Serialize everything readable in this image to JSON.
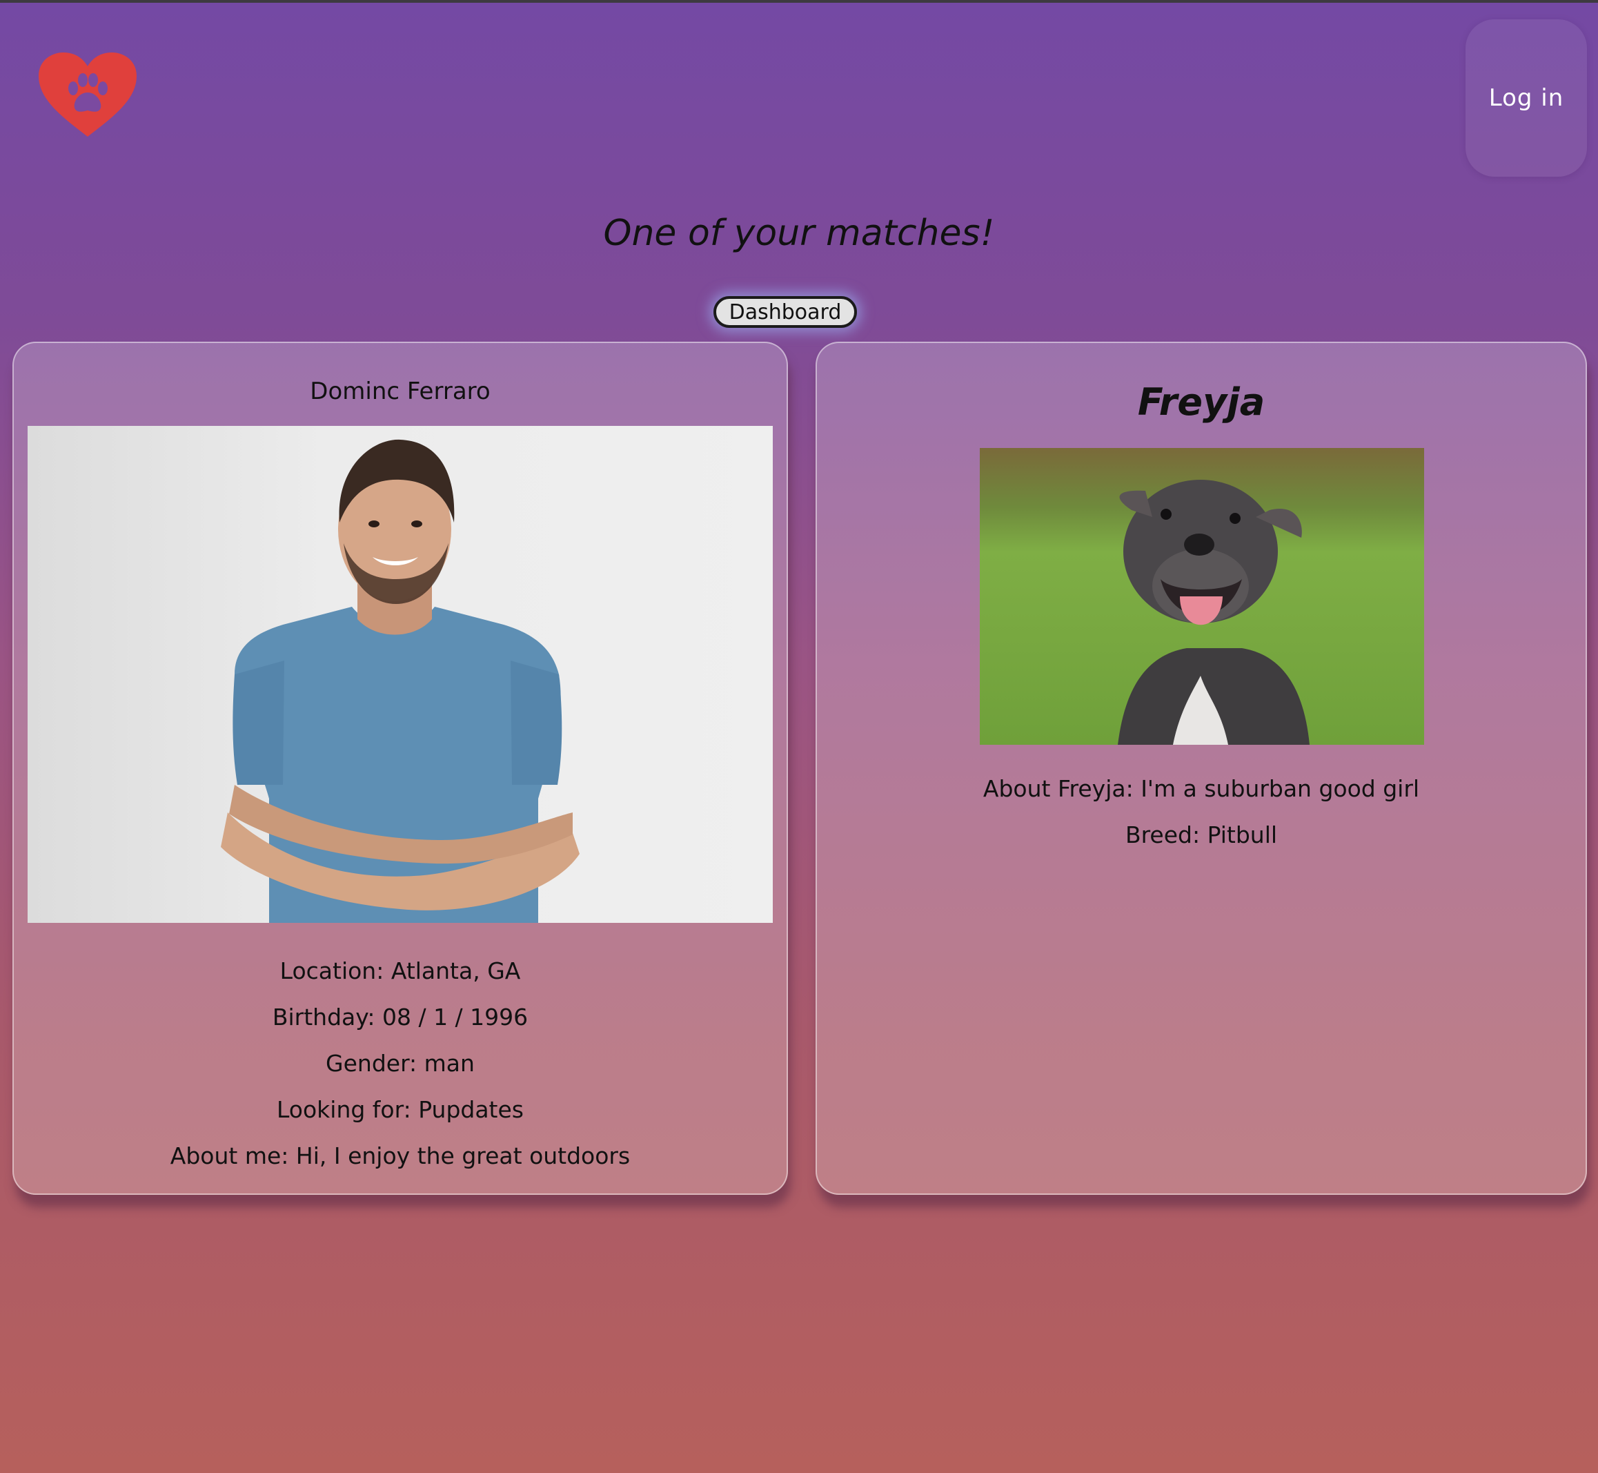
{
  "header": {
    "logo_icon": "heart-paw-icon",
    "logo_color": "#e0403c",
    "login_label": "Log in"
  },
  "main": {
    "title": "One of your matches!",
    "dashboard_label": "Dashboard"
  },
  "user_card": {
    "name": "Dominc Ferraro",
    "photo": "man-portrait-photo",
    "details": {
      "location": "Location: Atlanta, GA",
      "birthday": "Birthday: 08 / 1 / 1996",
      "gender": "Gender: man",
      "looking_for": "Looking for: Pupdates",
      "about": "About me: Hi, I enjoy the great outdoors"
    }
  },
  "pet_card": {
    "name": "Freyja",
    "photo": "dog-photo",
    "about": "About Freyja: I'm a suburban good girl",
    "breed": "Breed: Pitbull"
  }
}
